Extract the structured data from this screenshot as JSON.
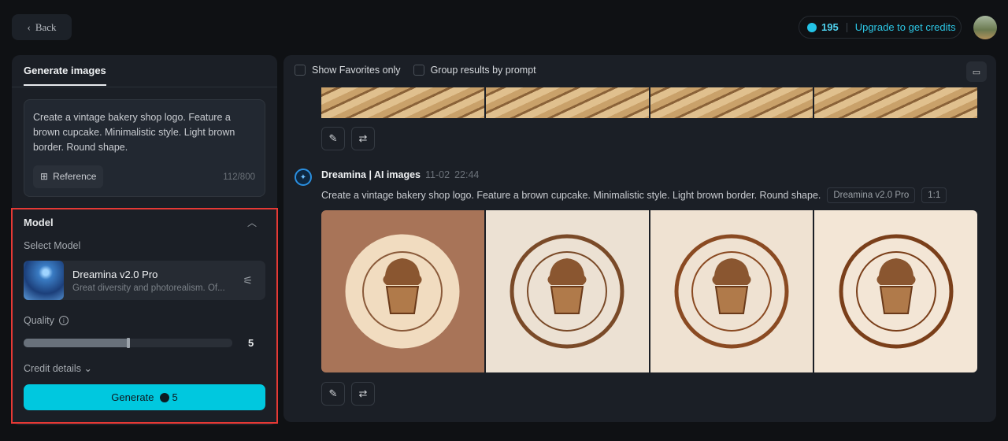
{
  "header": {
    "back_label": "Back",
    "credits": "195",
    "upgrade_label": "Upgrade to get credits"
  },
  "left": {
    "tab": "Generate images",
    "prompt": "Create a vintage bakery shop logo. Feature a brown cupcake. Minimalistic style. Light brown border. Round shape.",
    "reference_label": "Reference",
    "char_count": "112/800",
    "model_section": "Model",
    "select_model_label": "Select Model",
    "model_name": "Dreamina v2.0 Pro",
    "model_desc": "Great diversity and photorealism. Of...",
    "quality_label": "Quality",
    "quality_value": "5",
    "quality_fraction": 0.5,
    "credit_details": "Credit details",
    "generate_label": "Generate",
    "generate_cost": "5"
  },
  "right": {
    "show_favorites": "Show Favorites only",
    "group_results": "Group results by prompt",
    "result": {
      "author": "Dreamina | AI images",
      "date": "11-02",
      "time": "22:44",
      "prompt": "Create a vintage bakery shop logo. Feature a brown cupcake. Minimalistic style. Light brown border. Round shape.",
      "model_chip": "Dreamina v2.0 Pro",
      "ratio_chip": "1:1"
    }
  },
  "images": [
    {
      "bg": "#a87458",
      "ring": "#f1dcc0"
    },
    {
      "bg": "#ece1d3",
      "ring": "#7a4a28"
    },
    {
      "bg": "#efe2d2",
      "ring": "#8a4a22"
    },
    {
      "bg": "#f3e6d6",
      "ring": "#7a3f1a"
    }
  ],
  "colors": {
    "accent": "#00c8df",
    "highlight_border": "#e53935"
  }
}
